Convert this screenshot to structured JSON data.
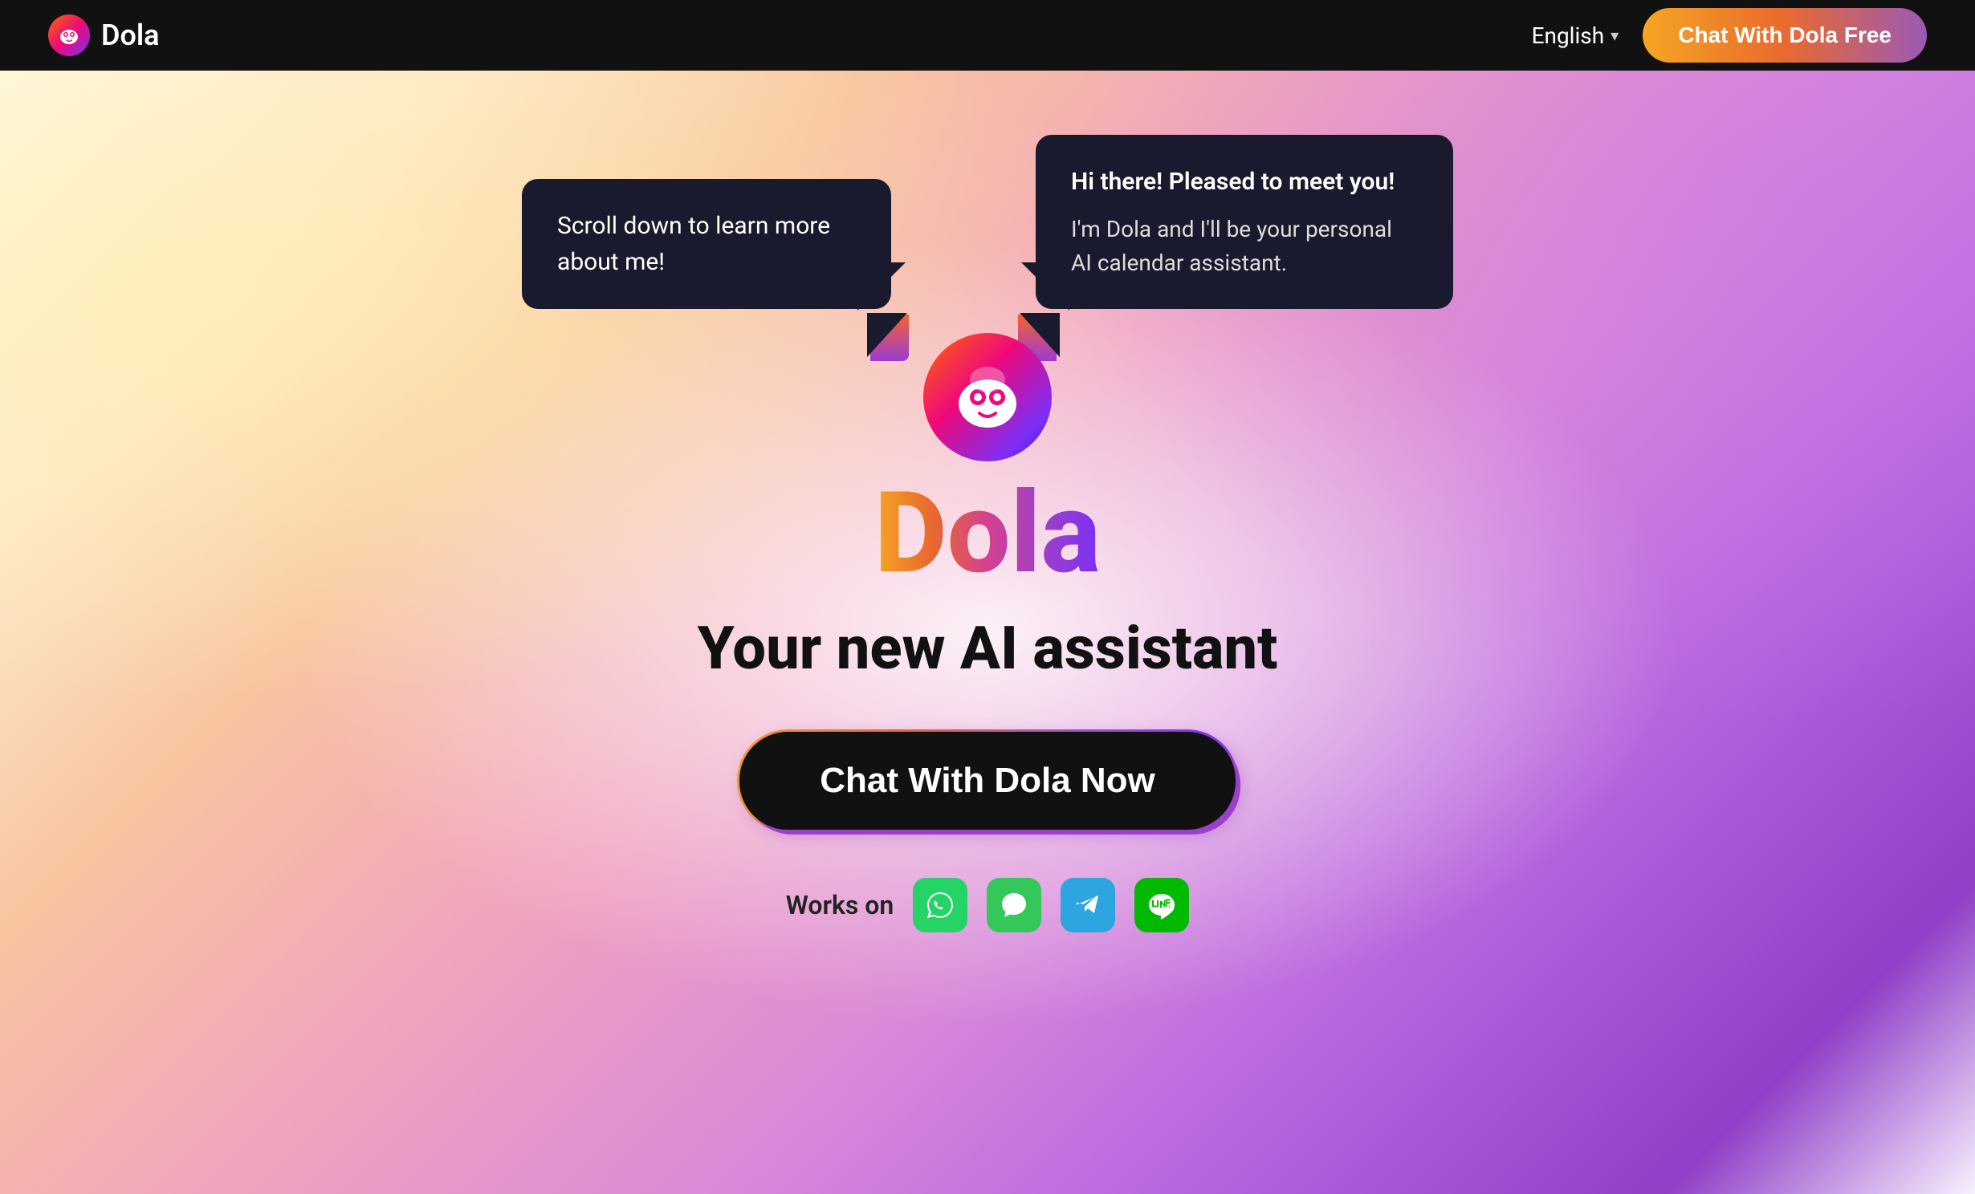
{
  "nav": {
    "logo_text": "Dola",
    "lang_label": "English",
    "cta_label": "Chat With Dola Free"
  },
  "hero": {
    "bubble_left": "Scroll down to learn more about me!",
    "bubble_right_line1": "Hi there! Pleased to meet you!",
    "bubble_right_line2": "I'm Dola and I'll be your personal AI calendar assistant.",
    "brand_name": "Dola",
    "tagline": "Your new AI assistant",
    "cta_label": "Chat With Dola Now",
    "works_on_label": "Works on",
    "platforms": [
      {
        "name": "WhatsApp",
        "icon": "💬"
      },
      {
        "name": "iMessage",
        "icon": "💬"
      },
      {
        "name": "Telegram",
        "icon": "✈"
      },
      {
        "name": "Line",
        "icon": "💬"
      }
    ]
  }
}
